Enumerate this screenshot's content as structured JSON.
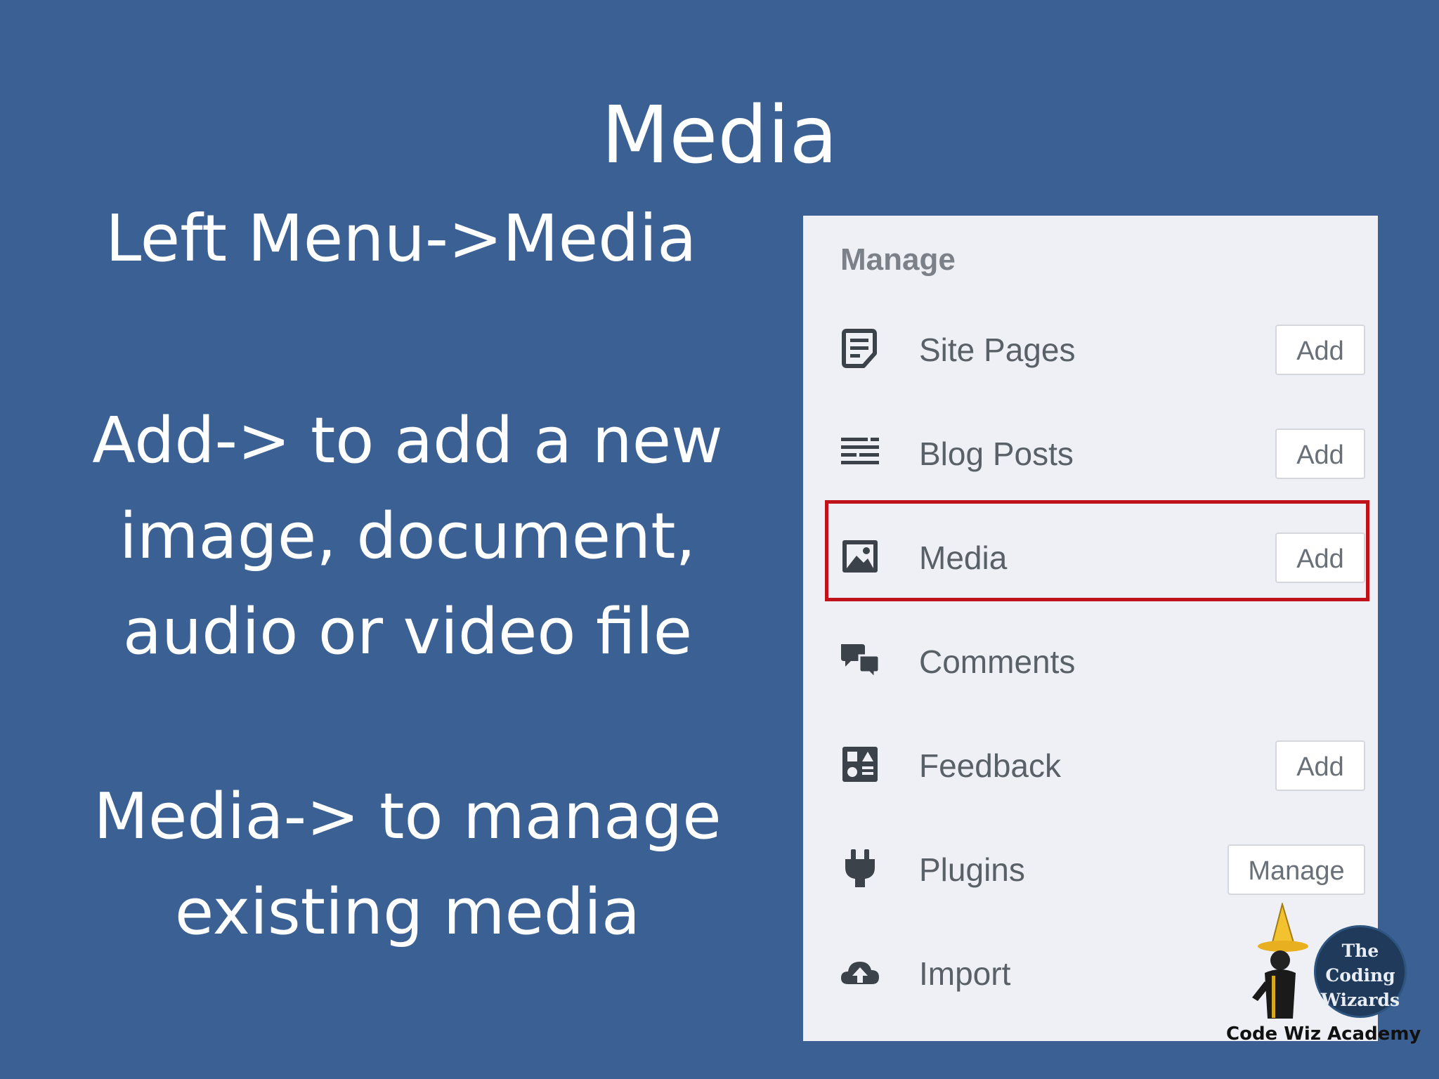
{
  "slide": {
    "title": "Media",
    "subheading": "Left Menu->Media",
    "paragraph1": [
      "Add-> to add a new",
      "image, document,",
      "audio or video file"
    ],
    "paragraph2": [
      "Media-> to manage",
      "existing media"
    ]
  },
  "panel": {
    "heading": "Manage",
    "items": [
      {
        "label": "Site Pages",
        "icon": "page-icon",
        "button": "Add"
      },
      {
        "label": "Blog Posts",
        "icon": "posts-icon",
        "button": "Add"
      },
      {
        "label": "Media",
        "icon": "image-icon",
        "button": "Add",
        "highlighted": true
      },
      {
        "label": "Comments",
        "icon": "comments-icon",
        "button": ""
      },
      {
        "label": "Feedback",
        "icon": "feedback-icon",
        "button": "Add"
      },
      {
        "label": "Plugins",
        "icon": "plug-icon",
        "button": "Manage"
      },
      {
        "label": "Import",
        "icon": "cloud-upload-icon",
        "button": ""
      }
    ]
  },
  "logo": {
    "circle_lines": [
      "The",
      "Coding",
      "Wizards"
    ],
    "caption": "Code Wiz Academy"
  },
  "colors": {
    "background": "#3a6094",
    "panel": "#eef0f5",
    "highlight": "#c1121b"
  }
}
